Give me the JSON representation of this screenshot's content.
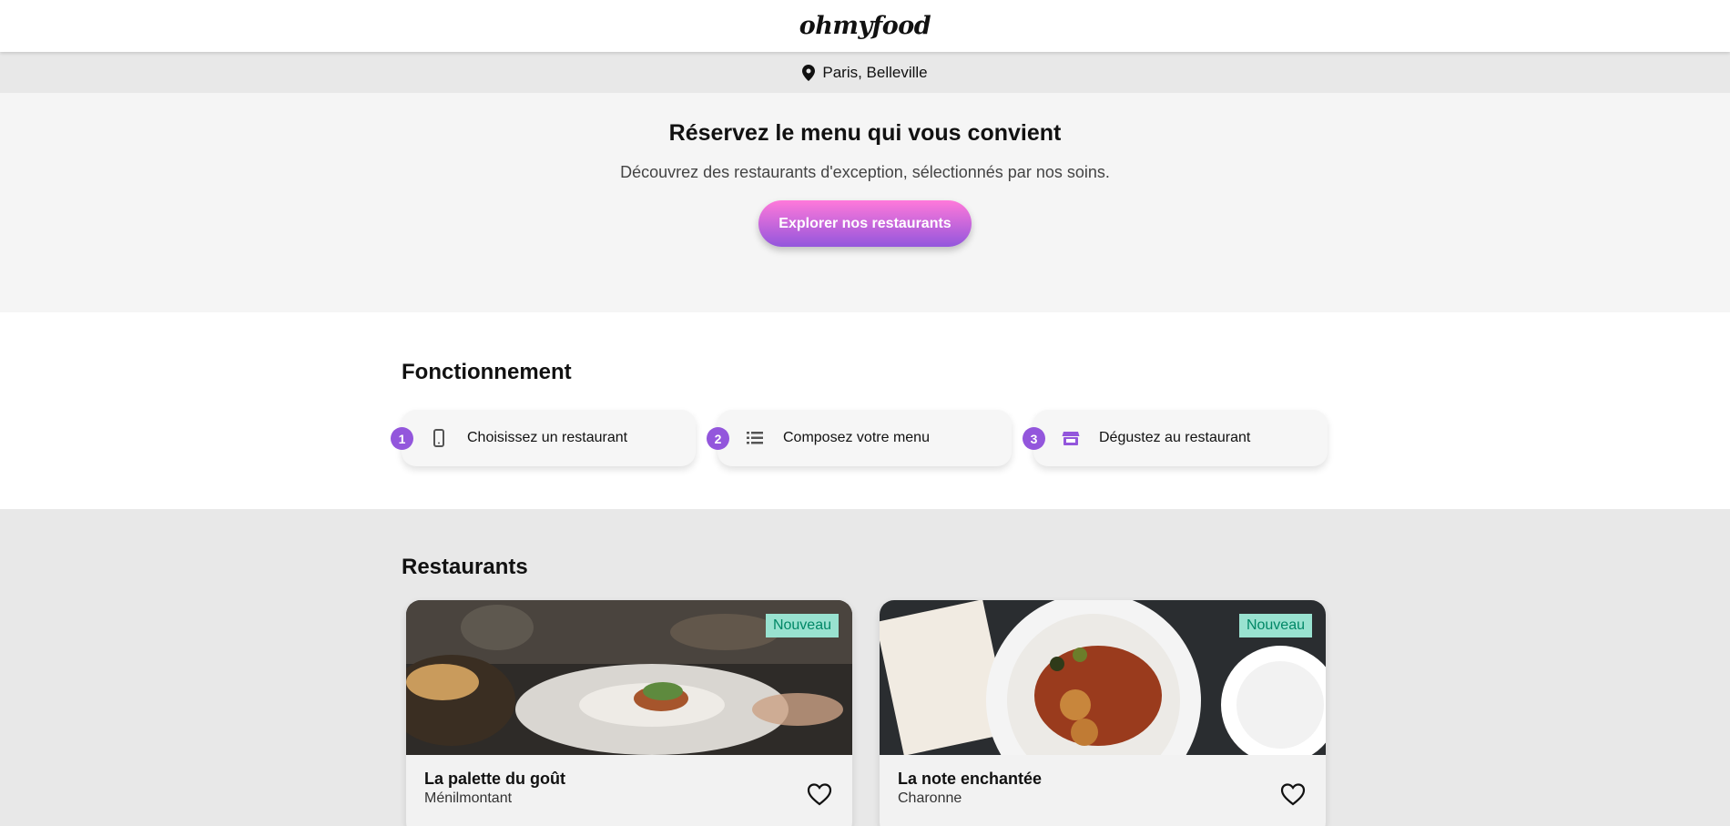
{
  "header": {
    "logo": "ohmyfood"
  },
  "location": {
    "icon": "map-pin-icon",
    "label": "Paris, Belleville"
  },
  "hero": {
    "title": "Réservez le menu qui vous convient",
    "subtitle": "Découvrez des restaurants d'exception, sélectionnés par nos soins.",
    "cta_label": "Explorer nos restaurants"
  },
  "how": {
    "title": "Fonctionnement",
    "steps": [
      {
        "num": "1",
        "icon": "smartphone-icon",
        "label": "Choisissez un restaurant"
      },
      {
        "num": "2",
        "icon": "list-icon",
        "label": "Composez votre menu"
      },
      {
        "num": "3",
        "icon": "store-icon",
        "label": "Dégustez au restaurant"
      }
    ]
  },
  "restaurants": {
    "title": "Restaurants",
    "items": [
      {
        "name": "La palette du goût",
        "area": "Ménilmontant",
        "badge": "Nouveau"
      },
      {
        "name": "La note enchantée",
        "area": "Charonne",
        "badge": "Nouveau"
      }
    ]
  },
  "colors": {
    "accent": "#9356dc",
    "cta_top": "#ff79da",
    "badge_bg": "#99e2d0",
    "badge_text": "#008766"
  }
}
